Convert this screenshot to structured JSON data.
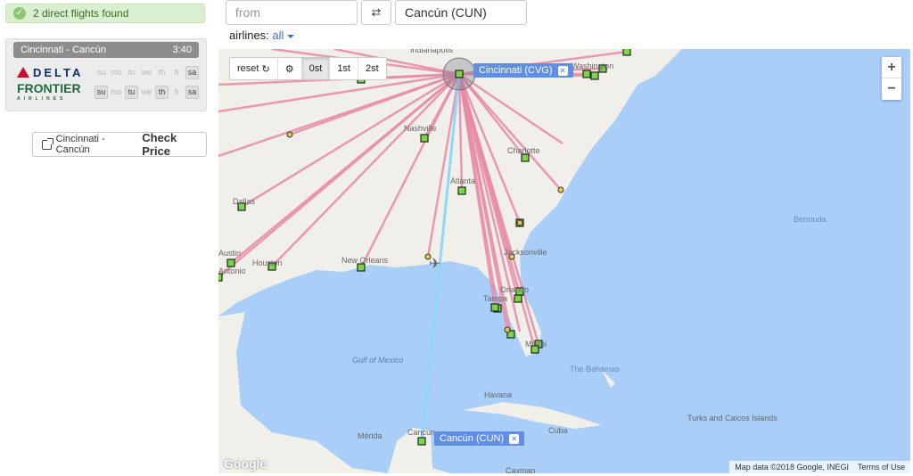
{
  "result": {
    "text": "2 direct flights found"
  },
  "route": {
    "title": "Cincinnati - Cancún",
    "duration": "3:40"
  },
  "airlines_list": [
    {
      "name": "DELTA",
      "days": [
        "su",
        "mo",
        "tu",
        "we",
        "th",
        "fr",
        "sa"
      ],
      "active": [
        false,
        false,
        false,
        false,
        false,
        false,
        true
      ]
    },
    {
      "name": "FRONTIER",
      "sub": "AIRLINES",
      "days": [
        "su",
        "mo",
        "tu",
        "we",
        "th",
        "fr",
        "sa"
      ],
      "active": [
        true,
        false,
        true,
        false,
        true,
        false,
        true
      ]
    }
  ],
  "check_price": {
    "route": "Cincinnati - Cancún",
    "label": "Check Price"
  },
  "search": {
    "from_placeholder": "from",
    "to_value": "Cancún (CUN)",
    "swap_icon": "swap-icon"
  },
  "airlines_filter": {
    "label": "airlines:",
    "value": "all"
  },
  "map": {
    "controls": [
      "reset",
      "0st",
      "1st",
      "2st"
    ],
    "active_control": "0st",
    "origin_tag": "Cincinnati (CVG)",
    "dest_tag": "Cancún (CUN)",
    "attribution": "Map data ©2018 Google, INEGI",
    "terms": "Terms of Use",
    "logo": "Google",
    "place_labels": [
      "Indianapolis",
      "Washington",
      "Nashville",
      "Charlotte",
      "Atlanta",
      "Dallas",
      "Austin",
      "Houston",
      "Antonio",
      "New Orleans",
      "Jacksonville",
      "Orlando",
      "Tampa",
      "Miami",
      "The Bahamas",
      "Bermuda",
      "Gulf of Mexico",
      "Havana",
      "Cuba",
      "Turks and Caicos Islands",
      "Mérida",
      "Cancún",
      "Cayman"
    ],
    "colors": {
      "water": "#a9cef7",
      "land": "#f0efe9",
      "route": "#e88aa6",
      "direct": "#8fd8f8",
      "node": "#79d64a"
    }
  }
}
